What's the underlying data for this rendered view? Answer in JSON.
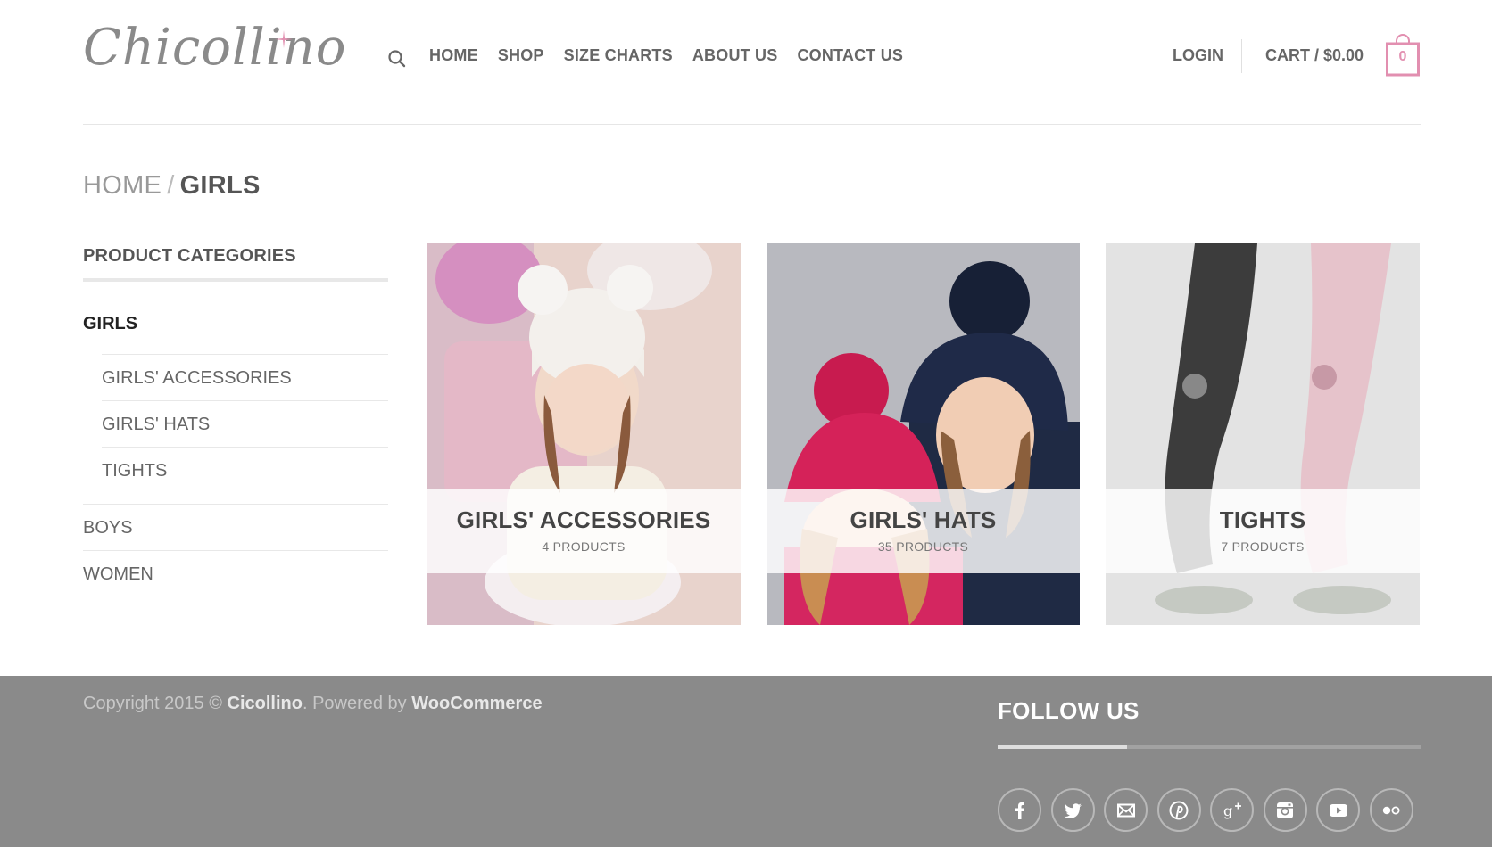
{
  "header": {
    "logo_text": "Chicollino",
    "nav": [
      {
        "label": "HOME"
      },
      {
        "label": "SHOP"
      },
      {
        "label": "SIZE CHARTS"
      },
      {
        "label": "ABOUT US"
      },
      {
        "label": "CONTACT US"
      }
    ],
    "login_label": "LOGIN",
    "cart_label": "CART / $0.00",
    "cart_count": "0"
  },
  "breadcrumb": {
    "home": "HOME",
    "separator": "/",
    "current": "GIRLS"
  },
  "sidebar": {
    "title": "PRODUCT CATEGORIES",
    "active": "GIRLS",
    "sub_items": [
      {
        "label": "GIRLS' ACCESSORIES"
      },
      {
        "label": "GIRLS' HATS"
      },
      {
        "label": "TIGHTS"
      }
    ],
    "other_items": [
      {
        "label": "BOYS"
      },
      {
        "label": "WOMEN"
      }
    ]
  },
  "categories": [
    {
      "title": "GIRLS' ACCESSORIES",
      "count": "4 PRODUCTS"
    },
    {
      "title": "GIRLS' HATS",
      "count": "35 PRODUCTS"
    },
    {
      "title": "TIGHTS",
      "count": "7 PRODUCTS"
    }
  ],
  "footer": {
    "copyright_prefix": "Copyright 2015 ©",
    "brand": "Cicollino",
    "powered_prefix": ". Powered by",
    "powered_link": "WooCommerce",
    "follow_title": "FOLLOW US",
    "social": [
      "facebook-icon",
      "twitter-icon",
      "email-icon",
      "pinterest-icon",
      "google-plus-icon",
      "instagram-icon",
      "youtube-icon",
      "flickr-icon"
    ]
  },
  "colors": {
    "accent_pink": "#e28fb0",
    "footer_bg": "#8a8a8a"
  }
}
